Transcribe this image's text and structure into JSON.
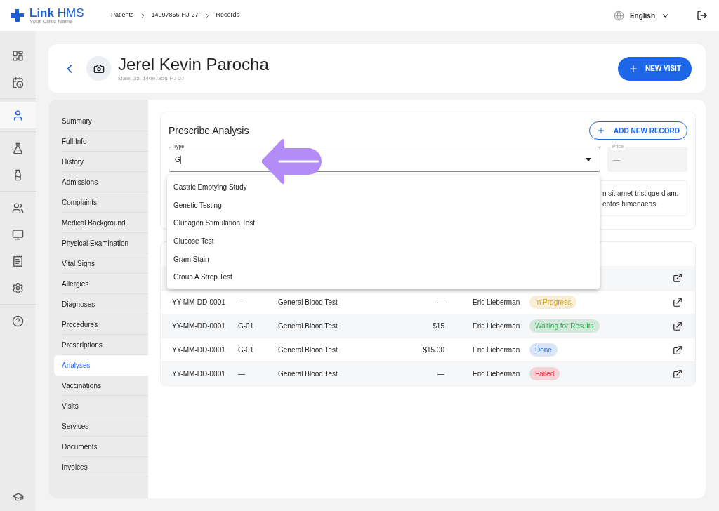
{
  "brand": {
    "name_bold": "Link",
    "name_light": "HMS",
    "subtitle": "Your Clinic Name"
  },
  "breadcrumbs": [
    "Patients",
    "14097856-HJ-27",
    "Records"
  ],
  "language": "English",
  "rail": [
    [
      {
        "selected": false
      },
      {
        "selected": false
      }
    ],
    [
      {
        "selected": true
      }
    ],
    [
      {
        "selected": false
      },
      {
        "selected": false
      }
    ],
    [
      {
        "selected": false
      },
      {
        "selected": false
      },
      {
        "selected": false
      },
      {
        "selected": false
      }
    ],
    [
      {
        "selected": false
      }
    ]
  ],
  "patient": {
    "name": "Jerel Kevin Parocha",
    "details": "Male, 35, 14097856-HJ-27",
    "action": "NEW VISIT"
  },
  "sections": [
    {
      "label": "Summary",
      "selected": false
    },
    {
      "label": "Full Info",
      "selected": false
    },
    {
      "label": "History",
      "selected": false
    },
    {
      "label": "Admissions",
      "selected": false
    },
    {
      "label": "Complaints",
      "selected": false
    },
    {
      "label": "Medical Background",
      "selected": false
    },
    {
      "label": "Physical Examination",
      "selected": false
    },
    {
      "label": "Vital Signs",
      "selected": false
    },
    {
      "label": "Allergies",
      "selected": false
    },
    {
      "label": "Diagnoses",
      "selected": false
    },
    {
      "label": "Procedures",
      "selected": false
    },
    {
      "label": "Prescriptions",
      "selected": false
    },
    {
      "label": "Analyses",
      "selected": true
    },
    {
      "label": "Vaccinations",
      "selected": false
    },
    {
      "label": "Visits",
      "selected": false
    },
    {
      "label": "Services",
      "selected": false
    },
    {
      "label": "Documents",
      "selected": false
    },
    {
      "label": "Invoices",
      "selected": false
    }
  ],
  "prescribe": {
    "title": "Prescribe Analysis",
    "add_button": "ADD NEW RECORD",
    "type_field": {
      "label": "Type",
      "value": "G"
    },
    "price_field": {
      "label": "Price",
      "value": "—"
    },
    "description_lines": [
      "n sit amet tristique diam.",
      "eptos himenaeos."
    ]
  },
  "suggestions": [
    "Gastric Emptying Study",
    "Genetic Testing",
    "Glucagon Stimulation Test",
    "Glucose Test",
    "Gram Stain",
    "Group A Strep Test"
  ],
  "table": {
    "rows": [
      {
        "number": "YY-MM-DD-0001",
        "code": "—",
        "analysis": "General Blood Test",
        "price": "—",
        "doctor": "Eric Lieberman",
        "status": "In Progress",
        "color": "#d9a21b"
      },
      {
        "number": "YY-MM-DD-0001",
        "code": "G-01",
        "analysis": "General Blood Test",
        "price": "$15",
        "doctor": "Eric Lieberman",
        "status": "Waiting for Results",
        "color": "#2fa84f"
      },
      {
        "number": "YY-MM-DD-0001",
        "code": "G-01",
        "analysis": "General Blood Test",
        "price": "$15.00",
        "doctor": "Eric Lieberman",
        "status": "Done",
        "color": "#2f6fe0"
      },
      {
        "number": "YY-MM-DD-0001",
        "code": "—",
        "analysis": "General Blood Test",
        "price": "—",
        "doctor": "Eric Lieberman",
        "status": "Failed",
        "color": "#e5333f"
      }
    ]
  }
}
